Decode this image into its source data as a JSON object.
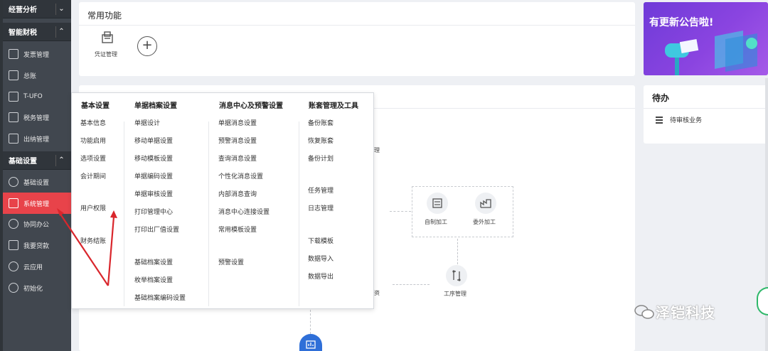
{
  "sidebar": {
    "groups": [
      {
        "label": "经营分析"
      },
      {
        "label": "智能财税"
      },
      {
        "label": "基础设置"
      }
    ],
    "items": [
      {
        "label": "发票管理",
        "icon": "invoice-icon"
      },
      {
        "label": "总账",
        "icon": "ledger-icon"
      },
      {
        "label": "T-UFO",
        "icon": "report-icon"
      },
      {
        "label": "税务管理",
        "icon": "tax-icon"
      },
      {
        "label": "出纳管理",
        "icon": "cashier-icon"
      },
      {
        "label": "基础设置",
        "icon": "gear-icon"
      },
      {
        "label": "系统管理",
        "icon": "system-icon"
      },
      {
        "label": "协同办公",
        "icon": "collab-icon"
      },
      {
        "label": "我要贷款",
        "icon": "loan-icon"
      },
      {
        "label": "云应用",
        "icon": "cloud-icon"
      },
      {
        "label": "初始化",
        "icon": "reset-icon"
      }
    ],
    "active_item": "系统管理"
  },
  "common_functions": {
    "title": "常用功能",
    "items": [
      {
        "label": "凭证管理",
        "icon": "voucher-icon"
      }
    ],
    "add_label": "+"
  },
  "banner": {
    "text": "有更新公告啦!"
  },
  "todo": {
    "title": "待办",
    "items": [
      {
        "label": "待审核业务",
        "icon": "list-icon"
      }
    ]
  },
  "dropdown": {
    "columns": [
      {
        "heading": "基本设置",
        "links": [
          "基本信息",
          "功能启用",
          "选项设置",
          "会计期间",
          "用户权限",
          "财务结账"
        ]
      },
      {
        "heading": "单据档案设置",
        "links": [
          "单据设计",
          "移动单据设置",
          "移动模板设置",
          "单据编码设置",
          "单据审核设置",
          "打印管理中心",
          "打印出厂值设置",
          "基础档案设置",
          "枚举档案设置",
          "基础档案编码设置"
        ]
      },
      {
        "heading": "消息中心及预警设置",
        "links": [
          "单据消息设置",
          "预警消息设置",
          "查询消息设置",
          "个性化消息设置",
          "内部消息查询",
          "消息中心连接设置",
          "常用模板设置",
          "预警设置"
        ]
      },
      {
        "heading": "账套管理及工具",
        "links": [
          "备份账套",
          "恢复账套",
          "备份计划",
          "任务管理",
          "日志管理",
          "下载模板",
          "数据导入",
          "数据导出"
        ]
      }
    ]
  },
  "flow": {
    "nodes": [
      {
        "label": "自制加工"
      },
      {
        "label": "委外加工"
      },
      {
        "label": "工序管理"
      }
    ],
    "partial_labels": [
      "理",
      "资"
    ]
  },
  "watermark": {
    "text": "泽铠科技"
  },
  "colors": {
    "sidebar_bg": "#41474f",
    "active_red": "#e8434a",
    "banner_purple": "#7a40dc",
    "arrow_red": "#d9262c"
  }
}
